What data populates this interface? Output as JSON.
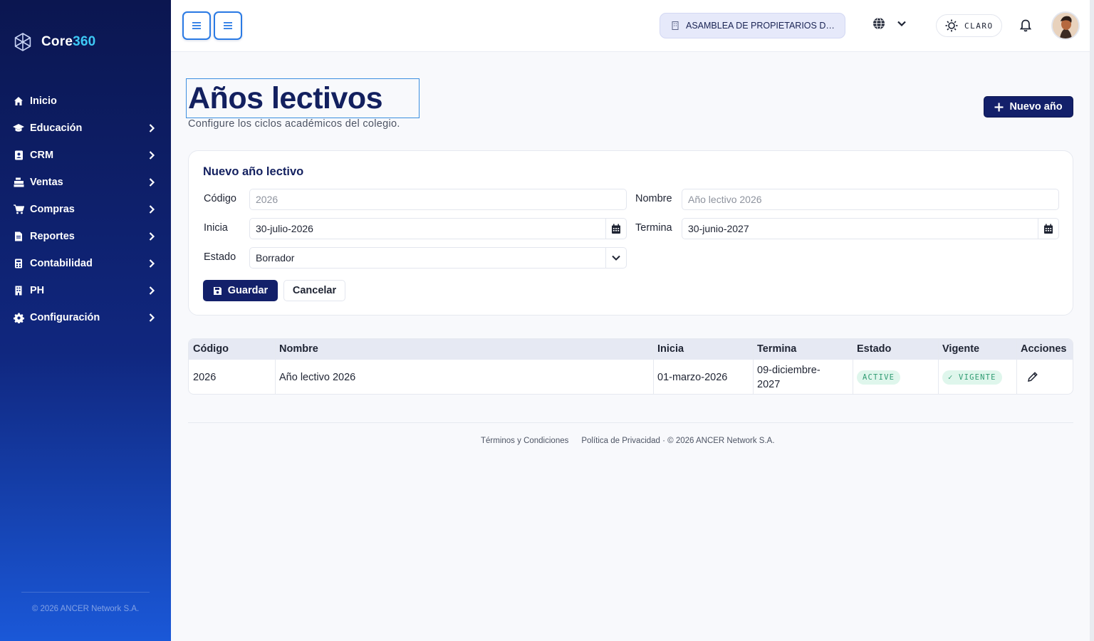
{
  "app": {
    "brand_part1": "Core",
    "brand_part2": "360",
    "copyright": "© 2026 ANCER Network S.A."
  },
  "sidebar": {
    "items": [
      {
        "label": "Inicio",
        "icon": "home-icon",
        "has_children": false
      },
      {
        "label": "Educación",
        "icon": "graduation-cap-icon",
        "has_children": true
      },
      {
        "label": "CRM",
        "icon": "contact-book-icon",
        "has_children": true
      },
      {
        "label": "Ventas",
        "icon": "cash-register-icon",
        "has_children": true
      },
      {
        "label": "Compras",
        "icon": "shopping-cart-icon",
        "has_children": true
      },
      {
        "label": "Reportes",
        "icon": "file-report-icon",
        "has_children": true
      },
      {
        "label": "Contabilidad",
        "icon": "calculator-icon",
        "has_children": true
      },
      {
        "label": "PH",
        "icon": "building-icon",
        "has_children": true
      },
      {
        "label": "Configuración",
        "icon": "gear-icon",
        "has_children": true
      }
    ]
  },
  "topbar": {
    "organization": "ASAMBLEA DE PROPIETARIOS DE LA TORRE",
    "theme_label": "CLARO"
  },
  "page": {
    "title": "Años lectivos",
    "subtitle": "Configure los ciclos académicos del colegio.",
    "new_button": "Nuevo año"
  },
  "form": {
    "title": "Nuevo año lectivo",
    "codigo_label": "Código",
    "codigo_placeholder": "2026",
    "nombre_label": "Nombre",
    "nombre_placeholder": "Año lectivo 2026",
    "inicia_label": "Inicia",
    "inicia_value": "30-julio-2026",
    "termina_label": "Termina",
    "termina_value": "30-junio-2027",
    "estado_label": "Estado",
    "estado_value": "Borrador",
    "save_label": "Guardar",
    "cancel_label": "Cancelar"
  },
  "table": {
    "headers": [
      "Código",
      "Nombre",
      "Inicia",
      "Termina",
      "Estado",
      "Vigente",
      "Acciones"
    ],
    "rows": [
      {
        "codigo": "2026",
        "nombre": "Año lectivo 2026",
        "inicia": "01-marzo-2026",
        "termina": "09-diciembre-2027",
        "estado": "ACTIVE",
        "vigente": "✓ VIGENTE"
      }
    ]
  },
  "footer": {
    "terms": "Términos y Condiciones",
    "privacy": "Política de Privacidad",
    "copyright": " · © 2026 ANCER Network S.A."
  },
  "colors": {
    "primary": "#13206a",
    "accent": "#3ec9f5",
    "success": "#2f9b72"
  }
}
